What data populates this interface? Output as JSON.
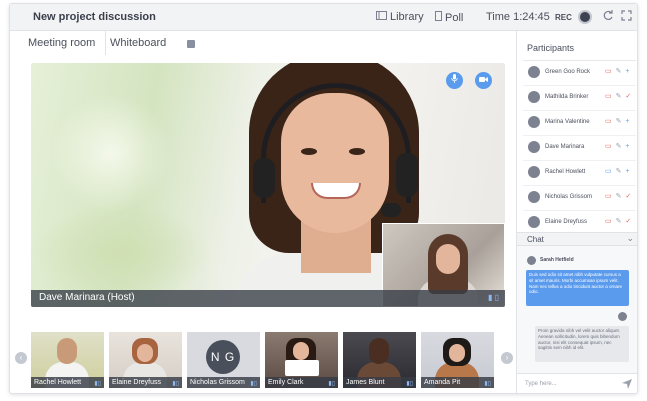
{
  "header": {
    "title": "New project discussion",
    "library_label": "Library",
    "poll_label": "Poll",
    "time_label": "Time 1:24:45",
    "rec_label": "REC"
  },
  "tabs": [
    {
      "label": "Meeting room"
    },
    {
      "label": "Whiteboard"
    }
  ],
  "main_video": {
    "host_label": "Dave Marinara (Host)"
  },
  "thumbnails": [
    {
      "name": "Rachel Howlett"
    },
    {
      "name": "Elaine Dreyfuss"
    },
    {
      "name": "Nicholas Grissom",
      "initials": "N G"
    },
    {
      "name": "Emily Clark"
    },
    {
      "name": "James Blunt"
    },
    {
      "name": "Amanda Pit"
    }
  ],
  "participants": {
    "title": "Participants",
    "items": [
      {
        "name": "Green Goo Rock"
      },
      {
        "name": "Mathilda Brinker"
      },
      {
        "name": "Marina Valentine"
      },
      {
        "name": "Dave Marinara"
      },
      {
        "name": "Rachel Howlett"
      },
      {
        "name": "Nicholas Grissom"
      },
      {
        "name": "Elaine Dreyfuss"
      }
    ]
  },
  "chat": {
    "title": "Chat",
    "messages": [
      {
        "sender": "Sarah Hetfield",
        "text": "Duis sed odio sit amet nibh vulputate cursus a sit amet mauris. Morbi accumsan ipsum velit. Nam nec tellus a odio tincidunt auctor a ornare odio."
      },
      {
        "text": "Proin gravida nibh vel velit auctor aliquet. Aenean sollicitudin, lorem quis bibendum auctor, nisi elit consequat ipsum, nec sagittis sem nibh id elit."
      }
    ],
    "input_placeholder": "Type here..."
  },
  "colors": {
    "accent": "#5b9bee",
    "topbar_bg": "#f2f3f5",
    "text": "#4a4f5c"
  }
}
